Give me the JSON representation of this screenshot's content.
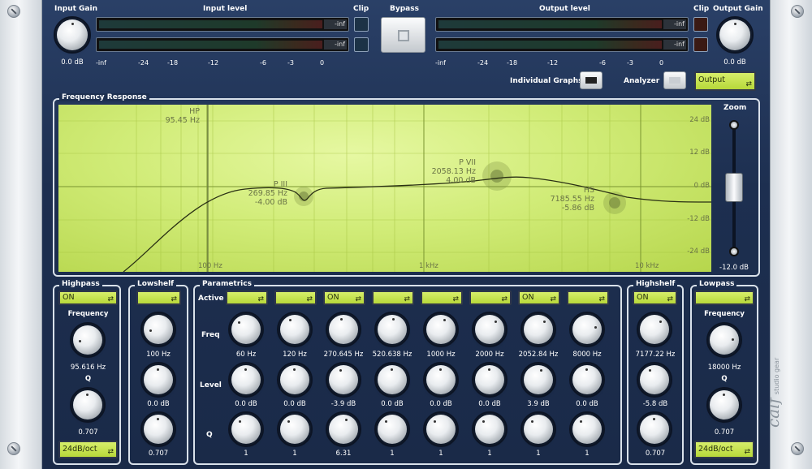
{
  "top": {
    "input_gain_label": "Input Gain",
    "input_gain_value": "0.0 dB",
    "input_level_label": "Input level",
    "input_meter_values": [
      "-inf",
      "-inf"
    ],
    "clip_label": "Clip",
    "bypass_label": "Bypass",
    "output_level_label": "Output level",
    "output_meter_values": [
      "-inf",
      "-inf"
    ],
    "clip_label_right": "Clip",
    "output_gain_label": "Output Gain",
    "output_gain_value": "0.0 dB",
    "scale": [
      "-inf",
      "-24",
      "-18",
      "-12",
      "-6",
      "-3",
      "0"
    ],
    "individual_graphs_label": "Individual Graphs",
    "analyzer_label": "Analyzer",
    "analyzer_mode": "Output"
  },
  "freq": {
    "title": "Frequency Response",
    "zoom_label": "Zoom",
    "zoom_value": "-12.0 dB",
    "db_labels": [
      "24 dB",
      "12 dB",
      "0 dB",
      "-12 dB",
      "-24 dB"
    ],
    "freq_labels": [
      "100 Hz",
      "1 kHz",
      "10 kHz"
    ],
    "markers": [
      {
        "name": "HP",
        "freq": "95.45 Hz",
        "gain": ""
      },
      {
        "name": "P III",
        "freq": "269.85 Hz",
        "gain": "-4.00 dB"
      },
      {
        "name": "P VII",
        "freq": "2058.13 Hz",
        "gain": "4.00 dB"
      },
      {
        "name": "HS",
        "freq": "7185.55 Hz",
        "gain": "-5.86 dB"
      }
    ]
  },
  "highpass": {
    "title": "Highpass",
    "state": "ON",
    "freq_label": "Frequency",
    "freq": "95.616 Hz",
    "q_label": "Q",
    "q": "0.707",
    "slope": "24dB/oct"
  },
  "lowshelf": {
    "title": "Lowshelf",
    "state": "",
    "freq": "100 Hz",
    "level": "0.0 dB",
    "q": "0.707"
  },
  "parametrics": {
    "title": "Parametrics",
    "active_label": "Active",
    "freq_label": "Freq",
    "level_label": "Level",
    "q_label": "Q",
    "bands": [
      {
        "state": "",
        "freq": "60 Hz",
        "level": "0.0 dB",
        "q": "1"
      },
      {
        "state": "",
        "freq": "120 Hz",
        "level": "0.0 dB",
        "q": "1"
      },
      {
        "state": "ON",
        "freq": "270.645 Hz",
        "level": "-3.9 dB",
        "q": "6.31"
      },
      {
        "state": "",
        "freq": "520.638 Hz",
        "level": "0.0 dB",
        "q": "1"
      },
      {
        "state": "",
        "freq": "1000 Hz",
        "level": "0.0 dB",
        "q": "1"
      },
      {
        "state": "",
        "freq": "2000 Hz",
        "level": "0.0 dB",
        "q": "1"
      },
      {
        "state": "ON",
        "freq": "2052.84 Hz",
        "level": "3.9 dB",
        "q": "1"
      },
      {
        "state": "",
        "freq": "8000 Hz",
        "level": "0.0 dB",
        "q": "1"
      }
    ]
  },
  "highshelf": {
    "title": "Highshelf",
    "state": "ON",
    "freq": "7177.22 Hz",
    "level": "-5.8 dB",
    "q": "0.707"
  },
  "lowpass": {
    "title": "Lowpass",
    "state": "",
    "freq_label": "Frequency",
    "freq": "18000 Hz",
    "q_label": "Q",
    "q": "0.707",
    "slope": "24dB/oct"
  },
  "brand": {
    "logo": "calf",
    "sub": "studio gear"
  }
}
